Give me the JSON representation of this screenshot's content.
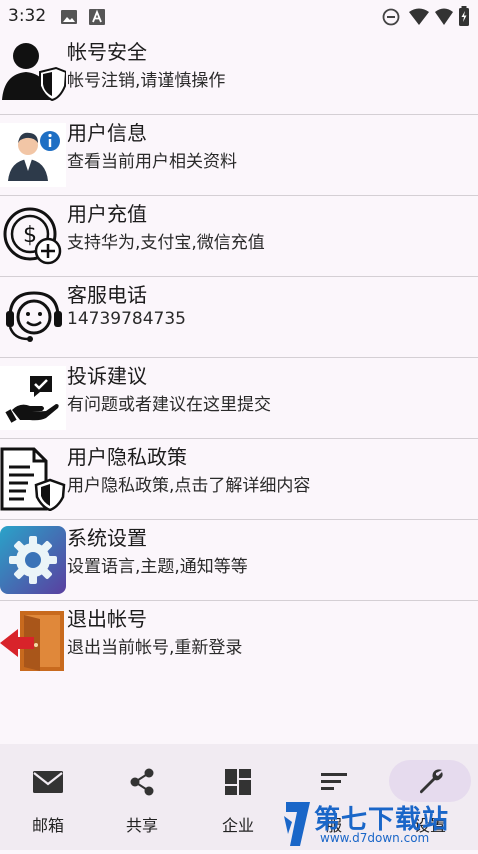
{
  "status_bar": {
    "time": "3:32",
    "icons": [
      "image-icon",
      "text-a-icon",
      "do-not-disturb-icon",
      "wifi-icon",
      "battery-icon"
    ]
  },
  "menu": {
    "items": [
      {
        "title": "帐号安全",
        "subtitle": "帐号注销,请谨慎操作",
        "icon": "account-shield-icon"
      },
      {
        "title": "用户信息",
        "subtitle": "查看当前用户相关资料",
        "icon": "user-info-icon"
      },
      {
        "title": "用户充值",
        "subtitle": "支持华为,支付宝,微信充值",
        "icon": "coin-add-icon"
      },
      {
        "title": "客服电话",
        "subtitle": "14739784735",
        "icon": "headset-icon"
      },
      {
        "title": "投诉建议",
        "subtitle": "有问题或者建议在这里提交",
        "icon": "feedback-hand-icon"
      },
      {
        "title": "用户隐私政策",
        "subtitle": "用户隐私政策,点击了解详细内容",
        "icon": "privacy-document-icon"
      },
      {
        "title": "系统设置",
        "subtitle": "设置语言,主题,通知等等",
        "icon": "settings-gear-icon"
      },
      {
        "title": "退出帐号",
        "subtitle": "退出当前帐号,重新登录",
        "icon": "logout-door-icon"
      }
    ]
  },
  "bottom_nav": {
    "items": [
      {
        "label": "邮箱",
        "icon": "mail-icon",
        "active": false
      },
      {
        "label": "共享",
        "icon": "share-icon",
        "active": false
      },
      {
        "label": "企业",
        "icon": "dashboard-icon",
        "active": false
      },
      {
        "label": "服",
        "icon": "list-icon",
        "active": false
      },
      {
        "label": "设置",
        "icon": "wrench-icon",
        "active": true
      }
    ]
  },
  "watermark": {
    "title": "第七下载站",
    "url": "www.d7down.com"
  },
  "colors": {
    "background": "#fbf6fb",
    "nav_background": "#f1ebf2",
    "nav_active_pill": "#e6dbee",
    "watermark_blue": "#1a66c8"
  }
}
